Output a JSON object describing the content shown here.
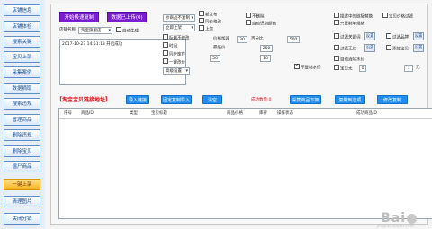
{
  "sidebar": {
    "items": [
      {
        "label": "店铺信息",
        "active": false
      },
      {
        "label": "店铺体检",
        "active": false
      },
      {
        "label": "搜索关键",
        "active": false
      },
      {
        "label": "宝贝上架",
        "active": false
      },
      {
        "label": "采集案例",
        "active": false
      },
      {
        "label": "数据摘取",
        "active": false
      },
      {
        "label": "搜索违规",
        "active": false
      },
      {
        "label": "管理商品",
        "active": false
      },
      {
        "label": "删除违规",
        "active": false
      },
      {
        "label": "删除宝贝",
        "active": false
      },
      {
        "label": "僵尸商品",
        "active": false
      },
      {
        "label": "一键上架",
        "active": true
      },
      {
        "label": "清理图片",
        "active": false
      },
      {
        "label": "关闭分销",
        "active": false
      }
    ]
  },
  "controls": {
    "start_button": "开始极速复制",
    "stop_button": "数据已上传(0)",
    "shop_label": "店铺名称",
    "shop_select": "淘宝旗舰店",
    "auto_tag": "自动生成",
    "log_text": "2017-10-23 14:51:13 开启成功",
    "copy_mode_select": "抄商品不复制",
    "stock_select": "立即上架",
    "cb_new_title": "新发布",
    "cb_price_same": "同价格改",
    "cb_shelf": "上架",
    "cb_no_delete": "不删除",
    "cb_extra": "不复制水印",
    "cb_auto_slice": "自动识别颜色",
    "cb_keep_title": "标题不修改",
    "cb_time": "时间",
    "cb_sync": "同步库存",
    "cb_one_key": "一键改价",
    "price_add_label": "价格加减",
    "price_add_value": "30",
    "price_pct_label": "百分比",
    "price_pct_value": "500",
    "price_min_label": "最低价",
    "price_min_value": "250",
    "price_max_value": "50",
    "max_price_value": "10",
    "advanced_select": "高级设置",
    "right_cb_1": "描述中的链接替换",
    "right_cb_2": "只复制单规格",
    "right_cb_3": "宝贝价格过滤",
    "right_cb_4": "过滤关键词",
    "right_cb_5": "过滤品牌",
    "right_cb_6": "过滤无效",
    "right_cb_7": "添加宝贝",
    "right_cb_8": "自动清除水印",
    "right_cb_9": "宝贝无",
    "setting_btn": "设置",
    "paste_btn": "设置",
    "yuan_label": "元",
    "yuan_value": "1",
    "count_value": "0"
  },
  "action_bar": {
    "title": "【淘宝宝贝链接地址】",
    "import_btn": "导入链接",
    "import_copy_btn": "固定复制导入",
    "clear_btn": "清空",
    "success_label": "成功数量:0",
    "collect_btn": "采集商品下架",
    "copy_all_btn": "复制到选项",
    "modify_btn": "修改复制"
  },
  "table": {
    "columns": [
      "序号",
      "商品ID",
      "类型",
      "宝贝标题",
      "商品价格",
      "库存",
      "操作状态",
      "成功商品ID"
    ]
  },
  "watermark": {
    "text": "Bai",
    "sub": "jingyan.baidu.com"
  },
  "colors": {
    "accent_purple": "#7a1ed1",
    "accent_blue": "#1f8ef0",
    "active_orange": "#f5b11e",
    "title_red": "#e0101a"
  }
}
